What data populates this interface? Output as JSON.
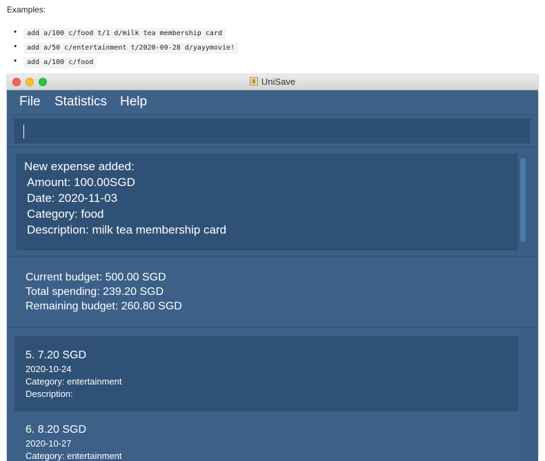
{
  "doc": {
    "heading": "Examples:",
    "examples": [
      "add a/100 c/food t/1 d/milk tea membership card",
      "add a/50 c/entertainment t/2020-09-28 d/yayymovie!",
      "add a/100 c/food"
    ]
  },
  "window": {
    "title": "UniSave"
  },
  "menu": {
    "file": "File",
    "statistics": "Statistics",
    "help": "Help"
  },
  "command": {
    "value": ""
  },
  "result": {
    "line1": "New expense added:",
    "line2": "Amount: 100.00SGD",
    "line3": "Date: 2020-11-03",
    "line4": "Category: food",
    "line5": "Description: milk tea membership card"
  },
  "budget": {
    "current": "Current budget: 500.00 SGD",
    "spending": "Total spending: 239.20 SGD",
    "remaining": "Remaining budget: 260.80 SGD"
  },
  "expenses": [
    {
      "title": "5.  7.20 SGD",
      "date": "2020-10-24",
      "category": "Category: entertainment",
      "description": "Description:"
    },
    {
      "title": "6.  8.20 SGD",
      "date": "2020-10-27",
      "category": "Category: entertainment"
    }
  ],
  "colors": {
    "window_bg": "#3b5f86",
    "panel_dark": "#2f5175",
    "text": "#ffffff"
  }
}
